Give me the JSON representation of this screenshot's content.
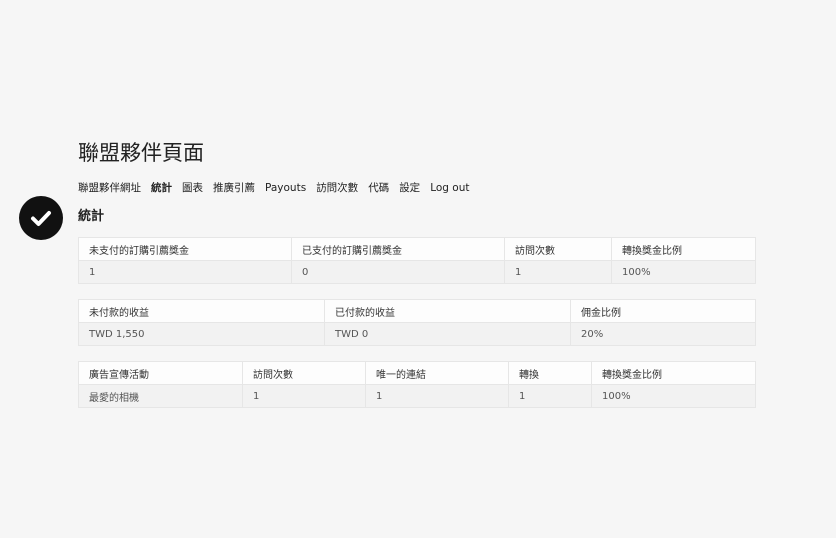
{
  "title": "聯盟夥伴頁面",
  "nav": [
    {
      "label": "聯盟夥伴網址"
    },
    {
      "label": "統計",
      "active": true
    },
    {
      "label": "圖表"
    },
    {
      "label": "推廣引薦"
    },
    {
      "label": "Payouts"
    },
    {
      "label": "訪問次數"
    },
    {
      "label": "代碼"
    },
    {
      "label": "設定"
    },
    {
      "label": "Log out"
    }
  ],
  "section_title": "統計",
  "status_icon": "check-circle-icon",
  "table1": {
    "headers": [
      "未支付的訂購引薦獎金",
      "已支付的訂購引薦獎金",
      "訪問次數",
      "轉換獎金比例"
    ],
    "row": [
      "1",
      "0",
      "1",
      "100%"
    ]
  },
  "table2": {
    "headers": [
      "未付款的收益",
      "已付款的收益",
      "佣金比例"
    ],
    "row": [
      "TWD 1,550",
      "TWD 0",
      "20%"
    ]
  },
  "table3": {
    "headers": [
      "廣告宣傳活動",
      "訪問次數",
      "唯一的連結",
      "轉換",
      "轉換獎金比例"
    ],
    "row": [
      "最愛的相機",
      "1",
      "1",
      "1",
      "100%"
    ]
  }
}
